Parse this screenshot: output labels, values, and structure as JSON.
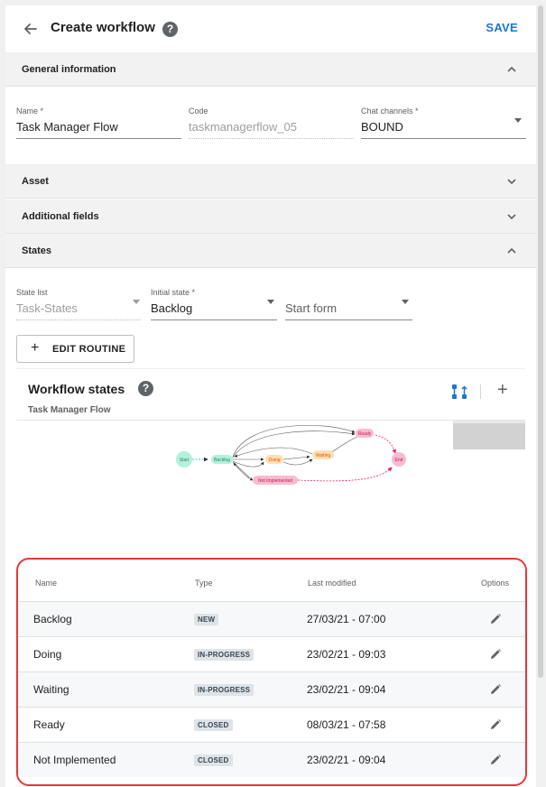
{
  "header": {
    "title": "Create workflow",
    "save_label": "SAVE"
  },
  "sections": {
    "general": "General information",
    "asset": "Asset",
    "additional": "Additional fields",
    "states": "States"
  },
  "general": {
    "name_label": "Name *",
    "name_value": "Task Manager Flow",
    "code_label": "Code",
    "code_value": "taskmanagerflow_05",
    "chat_label": "Chat channels *",
    "chat_value": "BOUND"
  },
  "states_form": {
    "state_list_label": "State list",
    "state_list_value": "Task-States",
    "initial_label": "Initial state *",
    "initial_value": "Backlog",
    "start_form_placeholder": "Start form",
    "edit_routine_label": "EDIT ROUTINE"
  },
  "workflow_states": {
    "title": "Workflow states",
    "subtitle": "Task Manager Flow",
    "diagram_nodes": [
      "Start",
      "Backlog",
      "Doing",
      "Waiting",
      "Ready",
      "End",
      "Not Implemented"
    ]
  },
  "table": {
    "columns": [
      "Name",
      "Type",
      "Last modified",
      "Options"
    ],
    "rows": [
      {
        "name": "Backlog",
        "type": "NEW",
        "modified": "27/03/21 - 07:00"
      },
      {
        "name": "Doing",
        "type": "IN-PROGRESS",
        "modified": "23/02/21 - 09:03"
      },
      {
        "name": "Waiting",
        "type": "IN-PROGRESS",
        "modified": "23/02/21 - 09:04"
      },
      {
        "name": "Ready",
        "type": "CLOSED",
        "modified": "08/03/21 - 07:58"
      },
      {
        "name": "Not Implemented",
        "type": "CLOSED",
        "modified": "23/02/21 - 09:04"
      }
    ]
  },
  "colors": {
    "accent": "#1976d2",
    "highlight_border": "#e53935",
    "node_start": "#b2f2dc",
    "node_backlog": "#b2f2dc",
    "node_doing": "#ffe0b2",
    "node_waiting": "#ffe0b2",
    "node_ready": "#f8bbd0",
    "node_end": "#f8bbd0",
    "node_not_implemented": "#f8bbd0"
  }
}
